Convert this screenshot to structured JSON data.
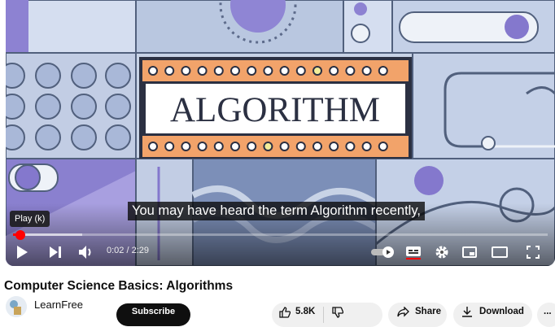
{
  "player": {
    "slide_title": "ALGORITHM",
    "tooltip": "Play (k)",
    "caption": "You may have heard the term Algorithm recently,",
    "time": "0:02 / 2:29",
    "progress_fraction": 0.013,
    "buffer_fraction": 0.13
  },
  "video": {
    "title": "Computer Science Basics: Algorithms"
  },
  "channel": {
    "name": "LearnFree",
    "subscribe_label": "Subscribe"
  },
  "actions": {
    "likes": "5.8K",
    "share_label": "Share",
    "download_label": "Download",
    "more_label": "..."
  },
  "colors": {
    "orange": "#f2a36a",
    "purple": "#7f72c9",
    "slate": "#7c8fb8",
    "light_blue": "#c8d3e6",
    "progress_red": "#ff0000"
  }
}
